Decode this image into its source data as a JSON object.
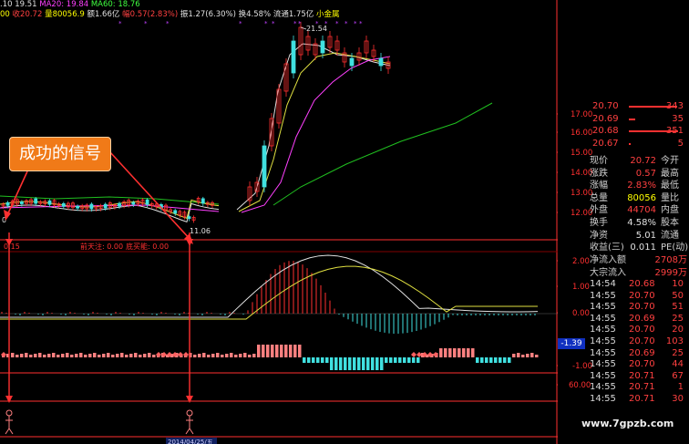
{
  "header": {
    "row1": [
      {
        "text": ".10 19.51",
        "color": "#e0e0e0"
      },
      {
        "text": "MA20: 19.84",
        "color": "#ff40ff"
      },
      {
        "text": "MA60: 18.76",
        "color": "#40ff40"
      }
    ],
    "row2": [
      {
        "text": "00",
        "color": "#ffff00"
      },
      {
        "text": "收20.72",
        "color": "#ff4040"
      },
      {
        "text": "量80056.9",
        "color": "#ffff00"
      },
      {
        "text": "额1.66亿",
        "color": "#e0e0e0"
      },
      {
        "text": "幅0.57(2.83%)",
        "color": "#ff4040"
      },
      {
        "text": "振1.27(6.30%)",
        "color": "#e0e0e0"
      },
      {
        "text": "换4.58%",
        "color": "#e0e0e0"
      },
      {
        "text": "流通1.75亿",
        "color": "#e0e0e0"
      },
      {
        "text": "小金属",
        "color": "#ffff00"
      }
    ]
  },
  "callout": {
    "text": "成功的信号"
  },
  "price_annotations": {
    "high": "21.54",
    "low": "11.06",
    "left": "0"
  },
  "price_axis": [
    "17.00",
    "16.00",
    "15.00",
    "14.00",
    "13.00",
    "12.00"
  ],
  "indicator_row": {
    "left": "0.15",
    "a": "前天注: 0.00",
    "b": "底买能: 0.00"
  },
  "macd_axis": [
    "2.00",
    "1.00",
    "0.00",
    "-1.00"
  ],
  "macd_value": "-1.39",
  "lower_axis": [
    "60.00"
  ],
  "date_label": "2014/04/25/五",
  "orderbook": [
    {
      "price": "20.70",
      "qty": "343",
      "bar": 62
    },
    {
      "price": "20.69",
      "qty": "35",
      "bar": 8
    },
    {
      "price": "20.68",
      "qty": "351",
      "bar": 64
    },
    {
      "price": "20.67",
      "qty": "5",
      "bar": 2
    }
  ],
  "quote": [
    {
      "l": "现价",
      "v": "20.72",
      "vc": "#ff4040",
      "r": "今开"
    },
    {
      "l": "涨跌",
      "v": "0.57",
      "vc": "#ff4040",
      "r": "最高"
    },
    {
      "l": "涨幅",
      "v": "2.83%",
      "vc": "#ff4040",
      "r": "最低"
    },
    {
      "l": "总量",
      "v": "80056",
      "vc": "#ffff00",
      "r": "量比"
    },
    {
      "l": "外盘",
      "v": "44704",
      "vc": "#ff4040",
      "r": "内盘"
    },
    {
      "l": "换手",
      "v": "4.58%",
      "vc": "#e0e0e0",
      "r": "股本"
    },
    {
      "l": "净资",
      "v": "5.01",
      "vc": "#e0e0e0",
      "r": "流通"
    },
    {
      "l": "收益(三)",
      "v": "0.011",
      "vc": "#e0e0e0",
      "r": "PE(动)"
    }
  ],
  "flows": [
    {
      "l": "净流入额",
      "v": "2708万"
    },
    {
      "l": "大宗流入",
      "v": "2999万"
    }
  ],
  "ticks": [
    {
      "t": "14:54",
      "p": "20.68",
      "v": "10"
    },
    {
      "t": "14:55",
      "p": "20.70",
      "v": "50"
    },
    {
      "t": "14:55",
      "p": "20.70",
      "v": "51"
    },
    {
      "t": "14:55",
      "p": "20.69",
      "v": "25"
    },
    {
      "t": "14:55",
      "p": "20.70",
      "v": "20"
    },
    {
      "t": "14:55",
      "p": "20.70",
      "v": "103"
    },
    {
      "t": "14:55",
      "p": "20.69",
      "v": "25"
    },
    {
      "t": "14:55",
      "p": "20.70",
      "v": "44"
    },
    {
      "t": "14:55",
      "p": "20.71",
      "v": "67"
    },
    {
      "t": "14:55",
      "p": "20.71",
      "v": "1"
    },
    {
      "t": "14:55",
      "p": "20.71",
      "v": "30"
    }
  ],
  "watermark": "www.7gpzb.com"
}
